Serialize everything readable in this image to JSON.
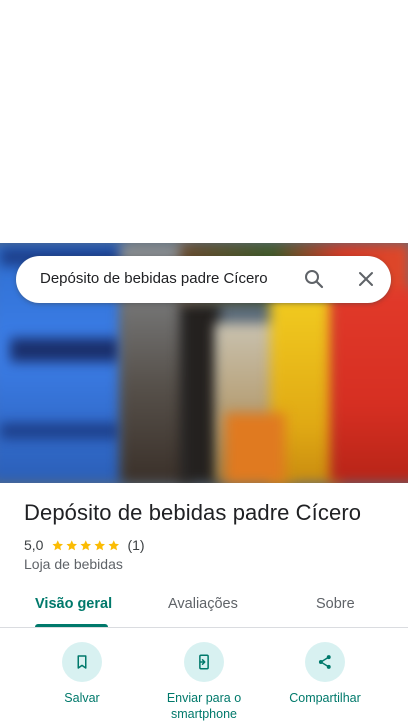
{
  "search": {
    "query": "Depósito de bebidas padre Cícero"
  },
  "place": {
    "name": "Depósito de bebidas padre Cícero",
    "rating": "5,0",
    "rating_stars": 5,
    "review_count": "(1)",
    "category": "Loja de bebidas"
  },
  "tabs": [
    {
      "label": "Visão geral",
      "active": true
    },
    {
      "label": "Avaliações",
      "active": false
    },
    {
      "label": "Sobre",
      "active": false
    }
  ],
  "actions": [
    {
      "label": "Salvar",
      "icon": "bookmark-icon"
    },
    {
      "label": "Enviar para o smartphone",
      "icon": "send-to-phone-icon"
    },
    {
      "label": "Compartilhar",
      "icon": "share-icon"
    }
  ],
  "colors": {
    "accent": "#00796b",
    "accent_bg": "#d8f1f1",
    "star": "#fbbc04",
    "text_primary": "#202124",
    "text_secondary": "#5f6368"
  }
}
